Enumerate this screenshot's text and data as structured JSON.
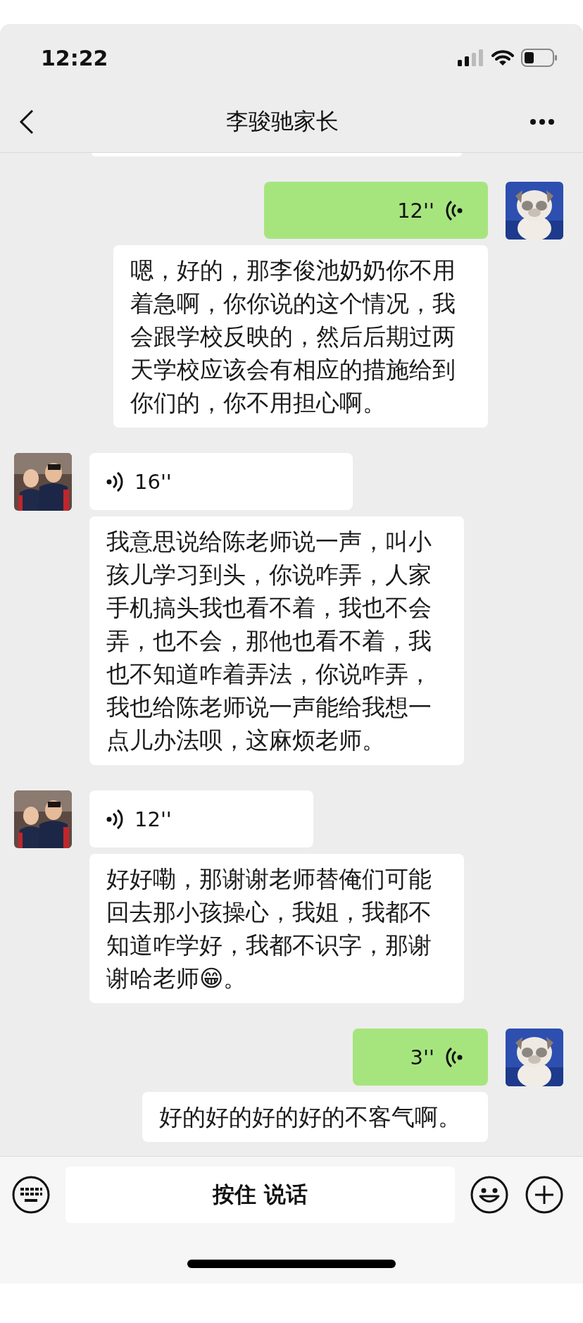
{
  "status_bar": {
    "time": "12:22"
  },
  "nav": {
    "title": "李骏驰家长"
  },
  "messages": [
    {
      "kind": "cut_off"
    },
    {
      "kind": "voice",
      "outgoing": true,
      "duration": "12''",
      "transcript": "嗯，好的，那李俊池奶奶你不用着急啊，你你说的这个情况，我会跟学校反映的，然后后期过两天学校应该会有相应的措施给到你们的，你不用担心啊。"
    },
    {
      "kind": "voice",
      "outgoing": false,
      "duration": "16''",
      "transcript": "我意思说给陈老师说一声，叫小孩儿学习到头，你说咋弄，人家手机搞头我也看不着，我也不会弄，也不会，那他也看不着，我也不知道咋着弄法，你说咋弄，我也给陈老师说一声能给我想一点儿办法呗，这麻烦老师。"
    },
    {
      "kind": "voice",
      "outgoing": false,
      "duration": "12''",
      "transcript": "好好嘞，那谢谢老师替俺们可能回去那小孩操心，我姐，我都不知道咋学好，我都不识字，那谢谢哈老师😁。"
    },
    {
      "kind": "voice",
      "outgoing": true,
      "duration": "3''",
      "transcript": "好的好的好的好的不客气啊。"
    }
  ],
  "input_bar": {
    "hold_to_talk": "按住 说话"
  }
}
